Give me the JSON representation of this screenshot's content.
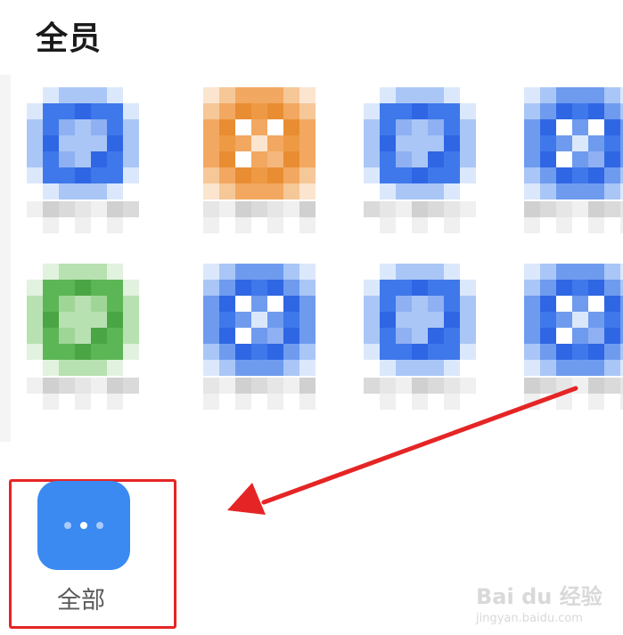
{
  "header": {
    "title": "全员"
  },
  "apps": [
    {
      "color": "blue",
      "label_hidden": true
    },
    {
      "color": "orange",
      "label_hidden": true
    },
    {
      "color": "blue",
      "label_hidden": true
    },
    {
      "color": "blue",
      "label_hidden": true
    },
    {
      "color": "green",
      "label_hidden": true
    },
    {
      "color": "blue",
      "label_hidden": true
    },
    {
      "color": "blue",
      "label_hidden": true
    },
    {
      "color": "blue",
      "label_hidden": true
    }
  ],
  "all_button": {
    "label": "全部",
    "icon": "more-dots-icon",
    "color": "#3a8af2"
  },
  "annotation": {
    "arrow_color": "#e52525",
    "box_color": "#e52525"
  },
  "watermark": {
    "brand": "Bai du 经验",
    "url": "jingyan.baidu.com"
  }
}
